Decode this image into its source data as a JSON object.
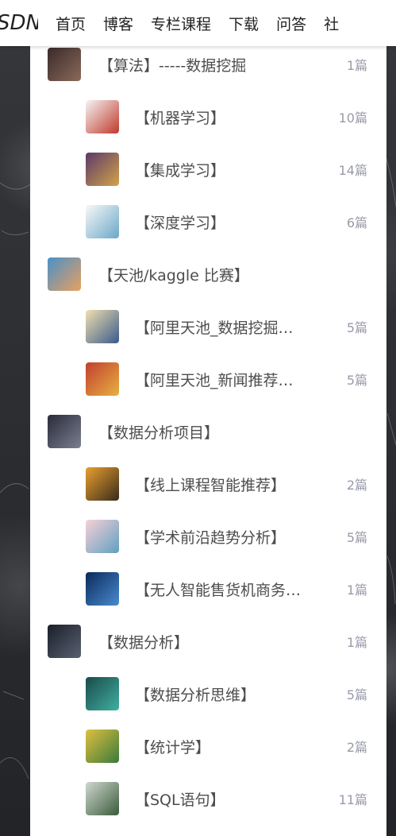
{
  "nav": {
    "logo": "SDN",
    "items": [
      "首页",
      "博客",
      "专栏课程",
      "下载",
      "问答",
      "社"
    ]
  },
  "columns": [
    {
      "label": "【算法】-----数据挖掘",
      "count": "1篇",
      "level": 1,
      "thumb": {
        "c1": "#3a2a2a",
        "c2": "#8a6a5a"
      }
    },
    {
      "label": "【机器学习】",
      "count": "10篇",
      "level": 2,
      "thumb": {
        "c1": "#f5f5f5",
        "c2": "#c0392b"
      }
    },
    {
      "label": "【集成学习】",
      "count": "14篇",
      "level": 2,
      "thumb": {
        "c1": "#5a3a6a",
        "c2": "#d4a24a"
      }
    },
    {
      "label": "【深度学习】",
      "count": "6篇",
      "level": 2,
      "thumb": {
        "c1": "#f8f8f8",
        "c2": "#6aa8c8"
      }
    },
    {
      "label": "【天池/kaggle 比赛】",
      "count": "",
      "level": 1,
      "thumb": {
        "c1": "#4a90c8",
        "c2": "#e8a060"
      }
    },
    {
      "label": "【阿里天池_数据挖掘…",
      "count": "5篇",
      "level": 2,
      "thumb": {
        "c1": "#f0e0b0",
        "c2": "#3a5a8a"
      }
    },
    {
      "label": "【阿里天池_新闻推荐…",
      "count": "5篇",
      "level": 2,
      "thumb": {
        "c1": "#c04030",
        "c2": "#e8b040"
      }
    },
    {
      "label": "【数据分析项目】",
      "count": "",
      "level": 1,
      "thumb": {
        "c1": "#2a2a3a",
        "c2": "#7a8090"
      }
    },
    {
      "label": "【线上课程智能推荐】",
      "count": "2篇",
      "level": 2,
      "thumb": {
        "c1": "#e8a030",
        "c2": "#3a2a1a"
      }
    },
    {
      "label": "【学术前沿趋势分析】",
      "count": "5篇",
      "level": 2,
      "thumb": {
        "c1": "#f8d0d8",
        "c2": "#60a0c0"
      }
    },
    {
      "label": "【无人智能售货机商务…",
      "count": "1篇",
      "level": 2,
      "thumb": {
        "c1": "#0a2a5a",
        "c2": "#4a8ad0"
      }
    },
    {
      "label": "【数据分析】",
      "count": "1篇",
      "level": 1,
      "thumb": {
        "c1": "#1a1f2a",
        "c2": "#5a6070"
      }
    },
    {
      "label": "【数据分析思维】",
      "count": "5篇",
      "level": 2,
      "thumb": {
        "c1": "#1a4a4a",
        "c2": "#40b0a0"
      }
    },
    {
      "label": "【统计学】",
      "count": "2篇",
      "level": 2,
      "thumb": {
        "c1": "#e0c040",
        "c2": "#3a7a3a"
      }
    },
    {
      "label": "【SQL语句】",
      "count": "11篇",
      "level": 2,
      "thumb": {
        "c1": "#d0d8d0",
        "c2": "#3a5a3a"
      }
    }
  ]
}
